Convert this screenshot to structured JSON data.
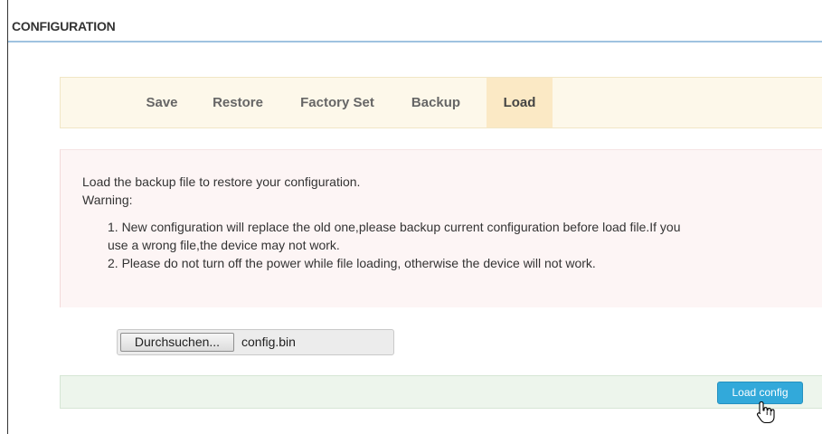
{
  "panel": {
    "title": "CONFIGURATION"
  },
  "tabs": [
    {
      "label": "Save",
      "active": false
    },
    {
      "label": "Restore",
      "active": false
    },
    {
      "label": "Factory Set",
      "active": false
    },
    {
      "label": "Backup",
      "active": false
    },
    {
      "label": "Load",
      "active": true
    }
  ],
  "notice": {
    "intro": "Load the backup file to restore your configuration.",
    "warning_label": "Warning:",
    "item1_line1": "1. New configuration will replace the old one,please backup current configuration before load file.If you",
    "item1_line2": "use a wrong file,the device may not work.",
    "item2": "2. Please do not turn off the power while file loading, otherwise the device will not work."
  },
  "file_upload": {
    "browse_label": "Durchsuchen...",
    "selected_file": "config.bin"
  },
  "actions": {
    "load_config_label": "Load config"
  },
  "colors": {
    "title_rule": "#9fc3e0",
    "tab_bar_bg": "#fdf8ea",
    "tab_active_bg": "#fbe9c5",
    "notice_bg": "#fdf5f5",
    "action_bar_bg": "#edf5ec",
    "primary_button": "#32a9da"
  },
  "icons": {
    "cursor": "hand-pointer-icon"
  }
}
